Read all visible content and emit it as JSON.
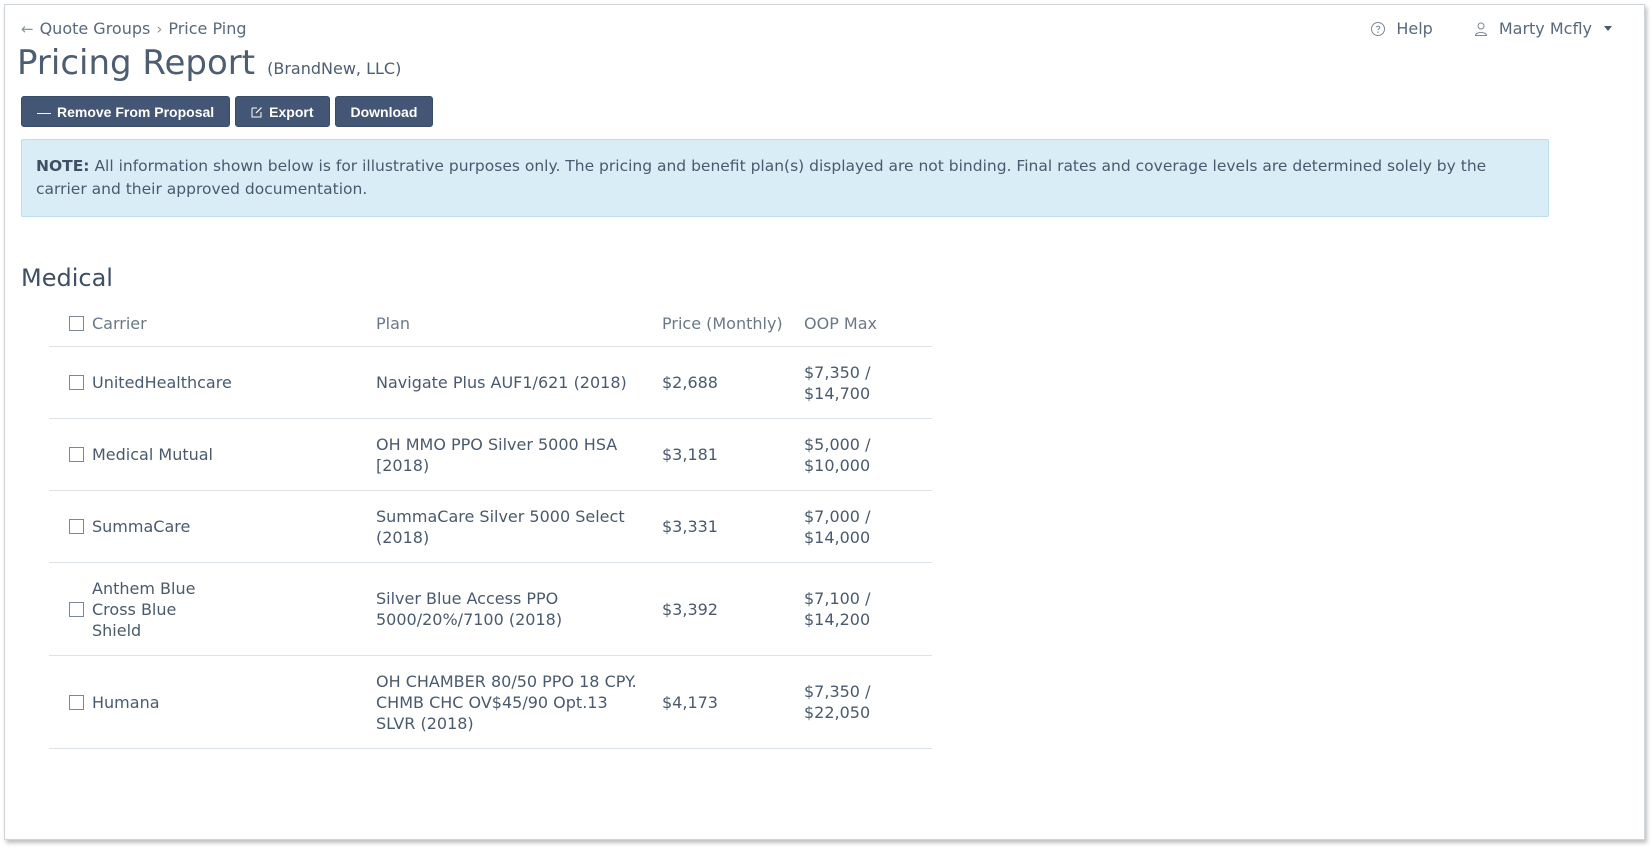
{
  "breadcrumb": {
    "back_label": "Quote Groups",
    "current_label": "Price Ping"
  },
  "usernav": {
    "help_label": "Help",
    "user_name": "Marty Mcfly"
  },
  "header": {
    "title": "Pricing Report",
    "subtitle": "(BrandNew, LLC)"
  },
  "toolbar": {
    "remove_label": "Remove From Proposal",
    "export_label": "Export",
    "download_label": "Download"
  },
  "note": {
    "prefix": "NOTE:",
    "text": "All information shown below is for illustrative purposes only. The pricing and benefit plan(s) displayed are not binding. Final rates and coverage levels are determined solely by the carrier and their approved documentation."
  },
  "medical": {
    "title": "Medical",
    "columns": {
      "carrier": "Carrier",
      "plan": "Plan",
      "price": "Price (Monthly)",
      "oop": "OOP Max"
    },
    "rows": [
      {
        "carrier": "UnitedHealthcare",
        "plan": "Navigate Plus AUF1/621 (2018)",
        "price": "$2,688",
        "oop_individual": "$7,350 /",
        "oop_family": "$14,700"
      },
      {
        "carrier": "Medical Mutual",
        "plan": "OH MMO PPO Silver 5000 HSA [2018)",
        "price": "$3,181",
        "oop_individual": "$5,000 /",
        "oop_family": "$10,000"
      },
      {
        "carrier": "SummaCare",
        "plan": "SummaCare Silver 5000 Select (2018)",
        "price": "$3,331",
        "oop_individual": "$7,000 /",
        "oop_family": "$14,000"
      },
      {
        "carrier": "Anthem Blue Cross Blue Shield",
        "plan": "Silver Blue Access PPO 5000/20%/7100 (2018)",
        "price": "$3,392",
        "oop_individual": "$7,100 /",
        "oop_family": "$14,200"
      },
      {
        "carrier": "Humana",
        "plan": "OH CHAMBER 80/50 PPO 18 CPY. CHMB CHC OV$45/90 Opt.13 SLVR (2018)",
        "price": "$4,173",
        "oop_individual": "$7,350 /",
        "oop_family": "$22,050"
      }
    ]
  },
  "colors": {
    "button_bg": "#435675",
    "note_bg": "#d9edf7",
    "text": "#4a5a6e"
  }
}
